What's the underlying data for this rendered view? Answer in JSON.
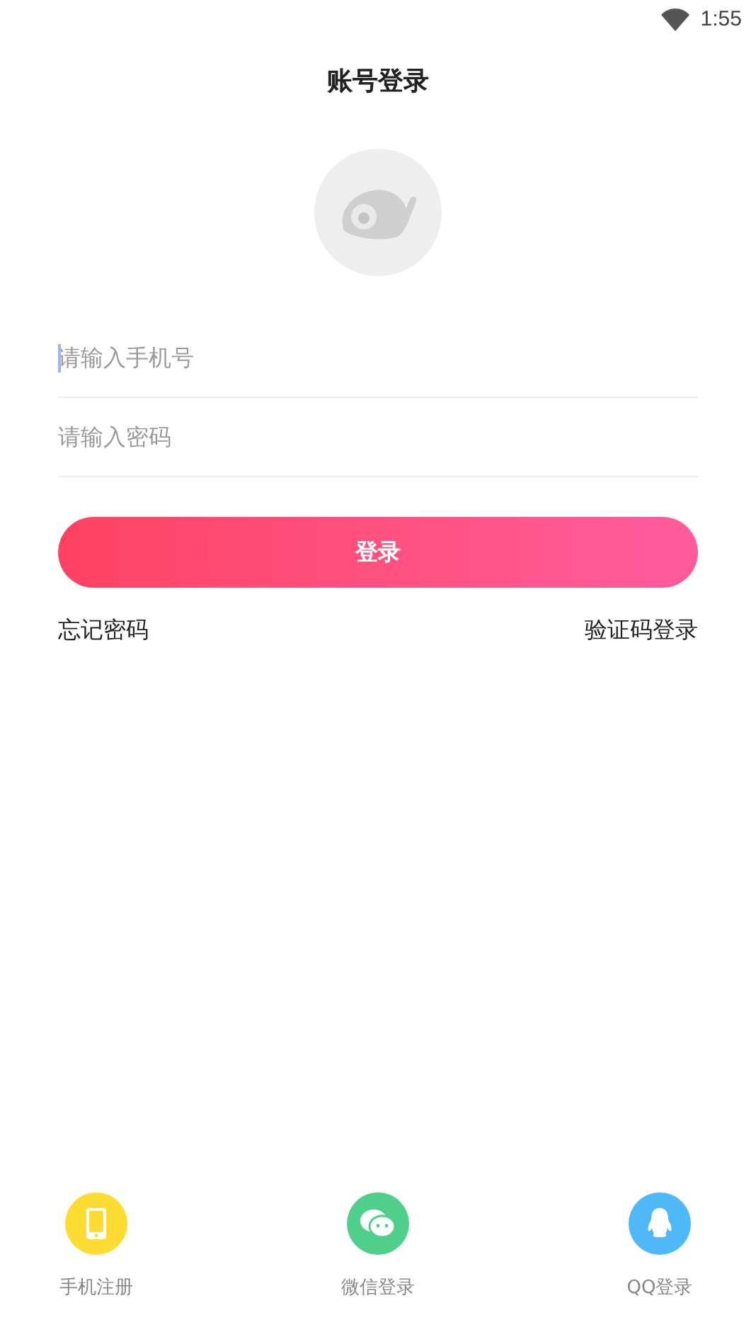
{
  "status_bar": {
    "time": "1:55"
  },
  "title": "账号登录",
  "fields": [
    {
      "placeholder": "请输入手机号",
      "focused": true
    },
    {
      "placeholder": "请输入密码",
      "focused": false
    }
  ],
  "login_button": "登录",
  "links": [
    "忘记密码",
    "验证码登录"
  ],
  "alt_logins": [
    {
      "kind": "phone",
      "label": "手机注册",
      "color": "#fddc33"
    },
    {
      "kind": "wechat",
      "label": "微信登录",
      "color": "#4fcf8a"
    },
    {
      "kind": "qq",
      "label": "QQ登录",
      "color": "#4fb8f7"
    }
  ]
}
